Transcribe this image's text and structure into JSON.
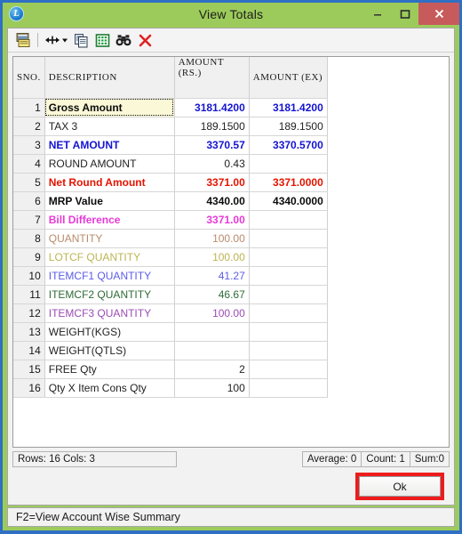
{
  "window": {
    "title": "View Totals",
    "app_icon": "L",
    "icon_name": "app-logo-icon",
    "buttons": {
      "minimize": "minimize-icon",
      "maximize": "maximize-icon",
      "close": "close-icon"
    },
    "colors": {
      "frame": "#9ccb5b",
      "outer_border": "#2f6fc4",
      "close_button": "#c75b5b",
      "highlight_red": "#ed1c1c"
    }
  },
  "toolbar": {
    "items": [
      {
        "name": "print-preview-icon",
        "tooltip": "Print"
      },
      {
        "name": "column-width-dropdown-icon",
        "tooltip": "Adjust Columns"
      },
      {
        "name": "copy-icon",
        "tooltip": "Copy"
      },
      {
        "name": "export-excel-icon",
        "tooltip": "Export to Excel"
      },
      {
        "name": "find-binoculars-icon",
        "tooltip": "Find"
      },
      {
        "name": "delete-red-x-icon",
        "tooltip": "Close"
      }
    ]
  },
  "grid": {
    "headers": {
      "sno": "SNO.",
      "description": "DESCRIPTION",
      "amount_line1": "AMOUNT",
      "amount_line2": "(RS.)",
      "amount_ex": "AMOUNT (EX)"
    },
    "rows": [
      {
        "sno": "1",
        "description": "Gross Amount",
        "amount": "3181.4200",
        "amount_ex": "3181.4200",
        "color": "#0b0b0b",
        "value_color": "#1414d2",
        "bold": true,
        "selected": true
      },
      {
        "sno": "2",
        "description": "TAX 3",
        "amount": "189.1500",
        "amount_ex": "189.1500",
        "color": "#222222",
        "value_color": "#222222",
        "bold": false,
        "selected": false
      },
      {
        "sno": "3",
        "description": "NET AMOUNT",
        "amount": "3370.57",
        "amount_ex": "3370.5700",
        "color": "#1414d2",
        "value_color": "#1414d2",
        "bold": true,
        "selected": false
      },
      {
        "sno": "4",
        "description": "ROUND AMOUNT",
        "amount": "0.43",
        "amount_ex": "",
        "color": "#222222",
        "value_color": "#222222",
        "bold": false,
        "selected": false
      },
      {
        "sno": "5",
        "description": "Net Round Amount",
        "amount": "3371.00",
        "amount_ex": "3371.0000",
        "color": "#e51400",
        "value_color": "#e51400",
        "bold": true,
        "selected": false
      },
      {
        "sno": "6",
        "description": "MRP Value",
        "amount": "4340.00",
        "amount_ex": "4340.0000",
        "color": "#0b0b0b",
        "value_color": "#0b0b0b",
        "bold": true,
        "selected": false
      },
      {
        "sno": "7",
        "description": "Bill Difference",
        "amount": "3371.00",
        "amount_ex": "",
        "color": "#e838d8",
        "value_color": "#e838d8",
        "bold": true,
        "selected": false
      },
      {
        "sno": "8",
        "description": "QUANTITY",
        "amount": "100.00",
        "amount_ex": "",
        "color": "#b98a6a",
        "value_color": "#b98a6a",
        "bold": false,
        "selected": false
      },
      {
        "sno": "9",
        "description": "LOTCF    QUANTITY",
        "amount": "100.00",
        "amount_ex": "",
        "color": "#bdb552",
        "value_color": "#bdb552",
        "bold": false,
        "selected": false
      },
      {
        "sno": "10",
        "description": "ITEMCF1  QUANTITY",
        "amount": "41.27",
        "amount_ex": "",
        "color": "#5b5be8",
        "value_color": "#5b5be8",
        "bold": false,
        "selected": false
      },
      {
        "sno": "11",
        "description": "ITEMCF2  QUANTITY",
        "amount": "46.67",
        "amount_ex": "",
        "color": "#2e6b36",
        "value_color": "#2e6b36",
        "bold": false,
        "selected": false
      },
      {
        "sno": "12",
        "description": "ITEMCF3  QUANTITY",
        "amount": "100.00",
        "amount_ex": "",
        "color": "#9b4bb5",
        "value_color": "#9b4bb5",
        "bold": false,
        "selected": false
      },
      {
        "sno": "13",
        "description": "WEIGHT(KGS)",
        "amount": "",
        "amount_ex": "",
        "color": "#222222",
        "value_color": "#222222",
        "bold": false,
        "selected": false
      },
      {
        "sno": "14",
        "description": "WEIGHT(QTLS)",
        "amount": "",
        "amount_ex": "",
        "color": "#222222",
        "value_color": "#222222",
        "bold": false,
        "selected": false
      },
      {
        "sno": "15",
        "description": "FREE Qty",
        "amount": "2",
        "amount_ex": "",
        "color": "#222222",
        "value_color": "#222222",
        "bold": false,
        "selected": false
      },
      {
        "sno": "16",
        "description": "Qty X Item Cons Qty",
        "amount": "100",
        "amount_ex": "",
        "color": "#222222",
        "value_color": "#222222",
        "bold": false,
        "selected": false
      }
    ]
  },
  "statusbar": {
    "rows_cols": "Rows: 16  Cols: 3",
    "average": "Average: 0",
    "count": "Count: 1",
    "sum": "Sum:0"
  },
  "footer": {
    "ok_label": "Ok",
    "hint": "F2=View Account Wise Summary"
  }
}
